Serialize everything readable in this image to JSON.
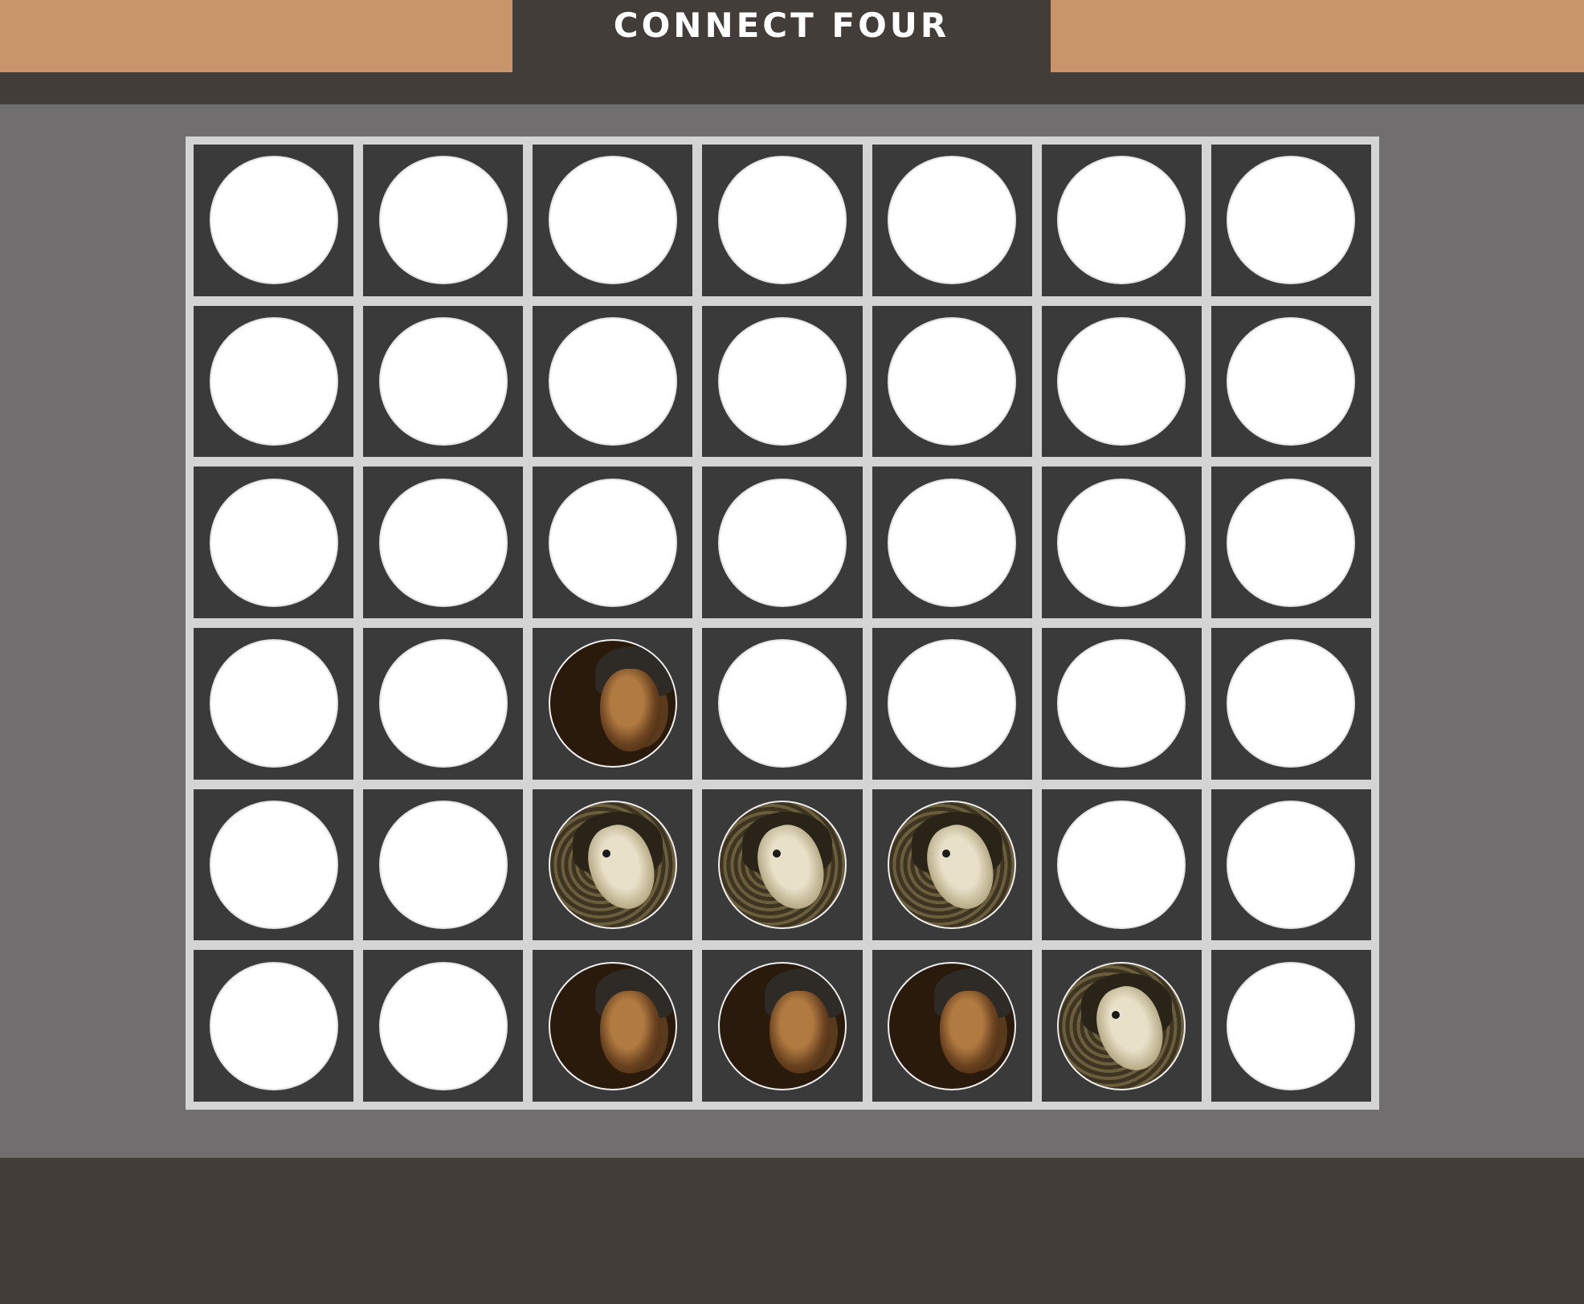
{
  "header": {
    "title": "CONNECT FOUR"
  },
  "colors": {
    "accent": "#c8946a",
    "dark": "#433d3a",
    "play_area": "#706e6f",
    "board_frame": "#d4d4d4",
    "cell": "#3a3a3a",
    "empty_disc": "#ffffff"
  },
  "board": {
    "columns": 7,
    "rows": 6,
    "cells": [
      [
        "empty",
        "empty",
        "empty",
        "empty",
        "empty",
        "empty",
        "empty"
      ],
      [
        "empty",
        "empty",
        "empty",
        "empty",
        "empty",
        "empty",
        "empty"
      ],
      [
        "empty",
        "empty",
        "empty",
        "empty",
        "empty",
        "empty",
        "empty"
      ],
      [
        "empty",
        "empty",
        "p1",
        "empty",
        "empty",
        "empty",
        "empty"
      ],
      [
        "empty",
        "empty",
        "p2",
        "p2",
        "p2",
        "empty",
        "empty"
      ],
      [
        "empty",
        "empty",
        "p1",
        "p1",
        "p1",
        "p2",
        "empty"
      ]
    ]
  },
  "pieces": {
    "p1": {
      "icon": "nebula-face-disc-icon"
    },
    "p2": {
      "icon": "sepia-face-disc-icon"
    }
  }
}
